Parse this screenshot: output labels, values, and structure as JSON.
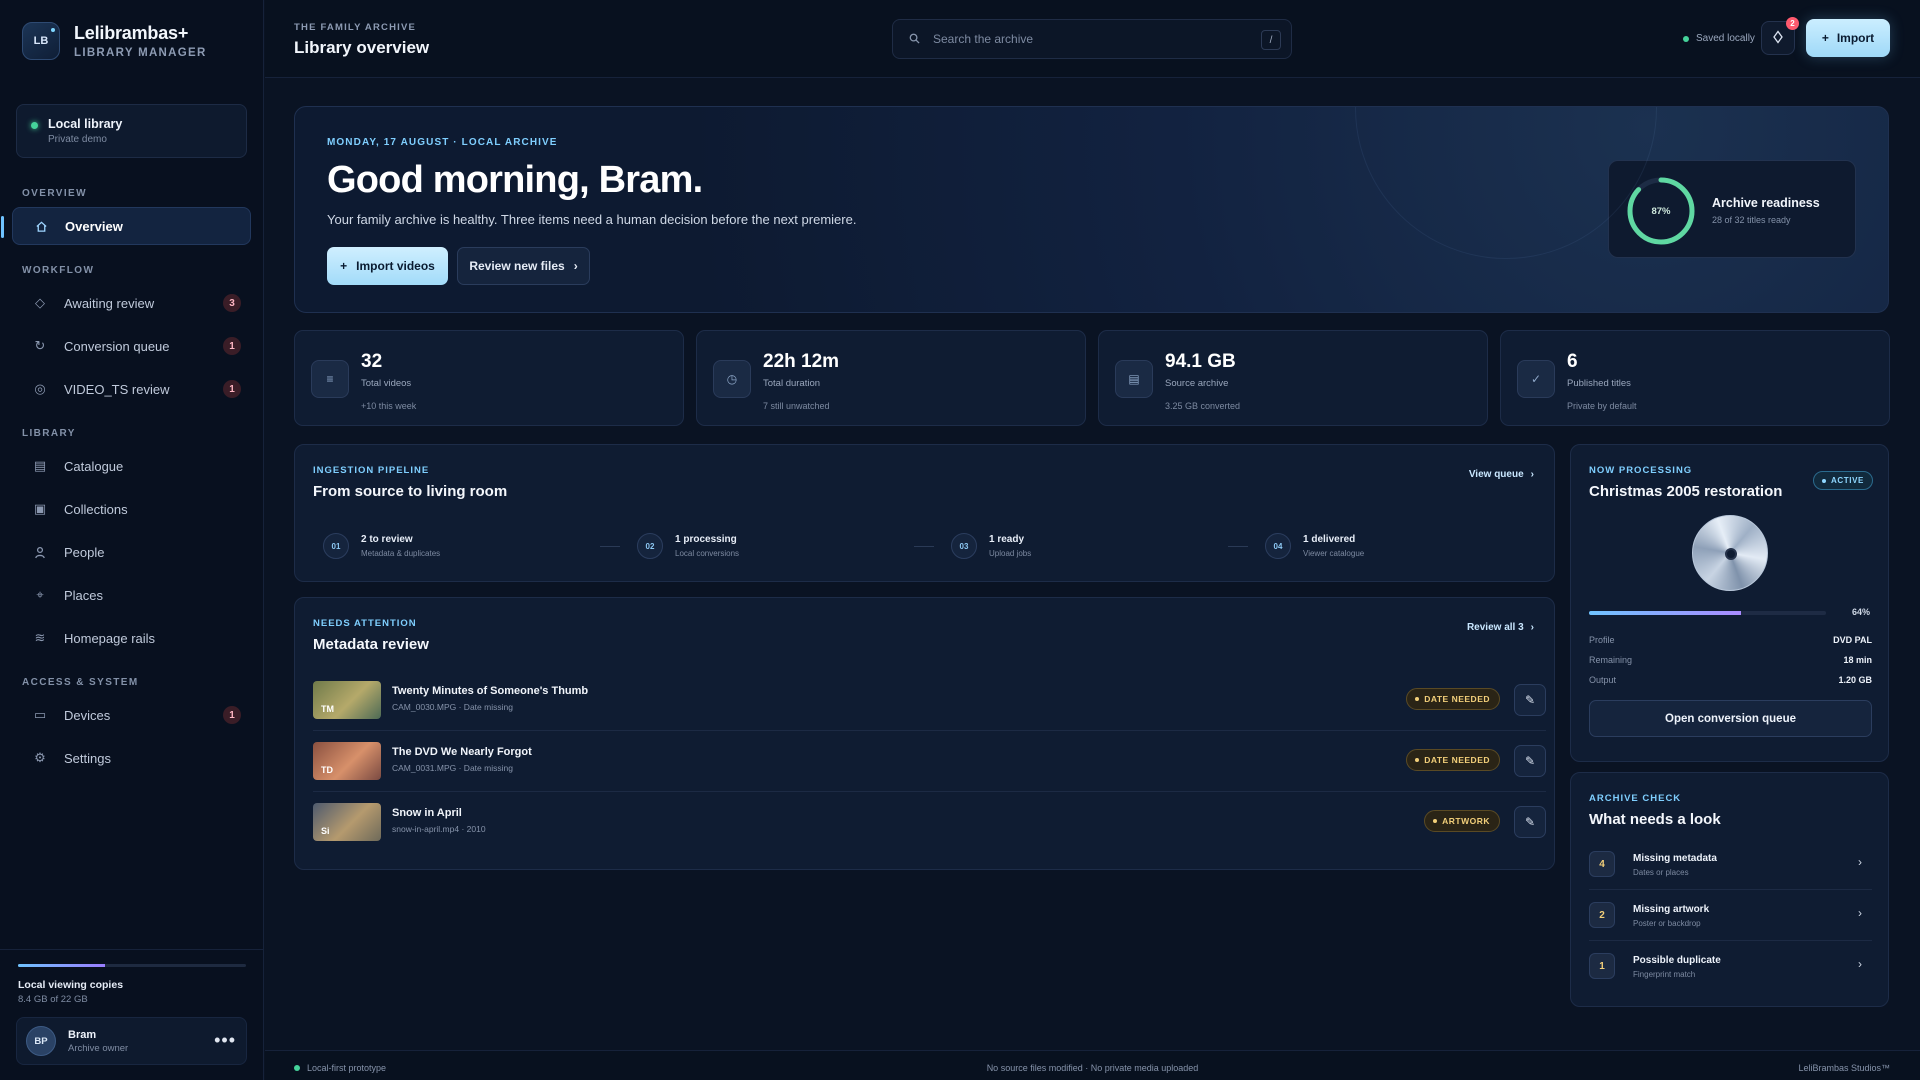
{
  "app": {
    "logo_initials": "LB",
    "name": "Lelibrambas+",
    "subtitle": "LIBRARY MANAGER"
  },
  "library_card": {
    "title": "Local library",
    "subtitle": "Private demo"
  },
  "sidebar": {
    "sections": {
      "overview": "OVERVIEW",
      "workflow": "WORKFLOW",
      "library": "LIBRARY",
      "access": "ACCESS & SYSTEM"
    },
    "items": [
      {
        "label": "Overview",
        "icon": "home-icon",
        "active": true
      },
      {
        "label": "Awaiting review",
        "icon": "diamond-icon",
        "badge": "3"
      },
      {
        "label": "Conversion queue",
        "icon": "refresh-icon",
        "badge": "1"
      },
      {
        "label": "VIDEO_TS review",
        "icon": "disc-icon",
        "badge": "1"
      },
      {
        "label": "Catalogue",
        "icon": "list-icon"
      },
      {
        "label": "Collections",
        "icon": "collection-icon"
      },
      {
        "label": "People",
        "icon": "person-icon"
      },
      {
        "label": "Places",
        "icon": "pin-icon"
      },
      {
        "label": "Homepage rails",
        "icon": "rails-icon"
      },
      {
        "label": "Devices",
        "icon": "device-icon",
        "badge": "1"
      },
      {
        "label": "Settings",
        "icon": "gear-icon"
      }
    ]
  },
  "storage": {
    "title": "Local viewing copies",
    "subtitle": "8.4 GB of 22 GB",
    "used_fraction": 0.38
  },
  "user": {
    "initials": "BP",
    "name": "Bram",
    "role": "Archive owner",
    "more": "•••"
  },
  "topbar": {
    "eyebrow": "THE FAMILY ARCHIVE",
    "title": "Library overview",
    "search_placeholder": "Search the archive",
    "search_shortcut": "/",
    "saved_status": "Saved locally",
    "notification_count": "2",
    "import_label": "Import"
  },
  "hero": {
    "eyebrow": "MONDAY, 17 AUGUST · LOCAL ARCHIVE",
    "title": "Good morning, Bram.",
    "subtitle": "Your family archive is healthy. Three items need a human decision before the next premiere.",
    "primary_button": "Import videos",
    "secondary_button": "Review new files",
    "readiness": {
      "percent_label": "87%",
      "value": 0.87,
      "title": "Archive readiness",
      "subtitle": "28 of 32 titles ready"
    }
  },
  "stats": [
    {
      "icon": "film-icon",
      "glyph": "≡",
      "value": "32",
      "label": "Total videos",
      "note": "+10 this week"
    },
    {
      "icon": "clock-icon",
      "glyph": "◷",
      "value": "22h 12m",
      "label": "Total duration",
      "note": "7 still unwatched"
    },
    {
      "icon": "storage-icon",
      "glyph": "▤",
      "value": "94.1 GB",
      "label": "Source archive",
      "note": "3.25 GB converted"
    },
    {
      "icon": "check-icon",
      "glyph": "✓",
      "value": "6",
      "label": "Published titles",
      "note": "Private by default"
    }
  ],
  "pipeline": {
    "eyebrow": "INGESTION PIPELINE",
    "title": "From source to living room",
    "link": "View queue",
    "steps": [
      {
        "num": "01",
        "title": "2 to review",
        "sub": "Metadata & duplicates"
      },
      {
        "num": "02",
        "title": "1 processing",
        "sub": "Local conversions"
      },
      {
        "num": "03",
        "title": "1 ready",
        "sub": "Upload jobs"
      },
      {
        "num": "04",
        "title": "1 delivered",
        "sub": "Viewer catalogue"
      }
    ]
  },
  "attention": {
    "eyebrow": "NEEDS ATTENTION",
    "title": "Metadata review",
    "link": "Review all 3",
    "rows": [
      {
        "initials": "TM",
        "title": "Twenty Minutes of Someone's Thumb",
        "meta": "CAM_0030.MPG · Date missing",
        "badge": "DATE NEEDED"
      },
      {
        "initials": "TD",
        "title": "The DVD We Nearly Forgot",
        "meta": "CAM_0031.MPG · Date missing",
        "badge": "DATE NEEDED"
      },
      {
        "initials": "Si",
        "title": "Snow in April",
        "meta": "snow-in-april.mp4 · 2010",
        "badge": "ARTWORK"
      }
    ]
  },
  "processing": {
    "eyebrow": "NOW PROCESSING",
    "title": "Christmas 2005 restoration",
    "status": "ACTIVE",
    "progress": 0.64,
    "progress_label": "64%",
    "details": [
      {
        "key": "Profile",
        "value": "DVD PAL"
      },
      {
        "key": "Remaining",
        "value": "18 min"
      },
      {
        "key": "Output",
        "value": "1.20 GB"
      }
    ],
    "button": "Open conversion queue"
  },
  "archive_check": {
    "eyebrow": "ARCHIVE CHECK",
    "title": "What needs a look",
    "items": [
      {
        "count": "4",
        "title": "Missing metadata",
        "sub": "Dates or places"
      },
      {
        "count": "2",
        "title": "Missing artwork",
        "sub": "Poster or backdrop"
      },
      {
        "count": "1",
        "title": "Possible duplicate",
        "sub": "Fingerprint match"
      }
    ]
  },
  "footer": {
    "left": "Local-first prototype",
    "middle": "No source files modified · No private media uploaded",
    "right": "LeliBrambas Studios™"
  }
}
